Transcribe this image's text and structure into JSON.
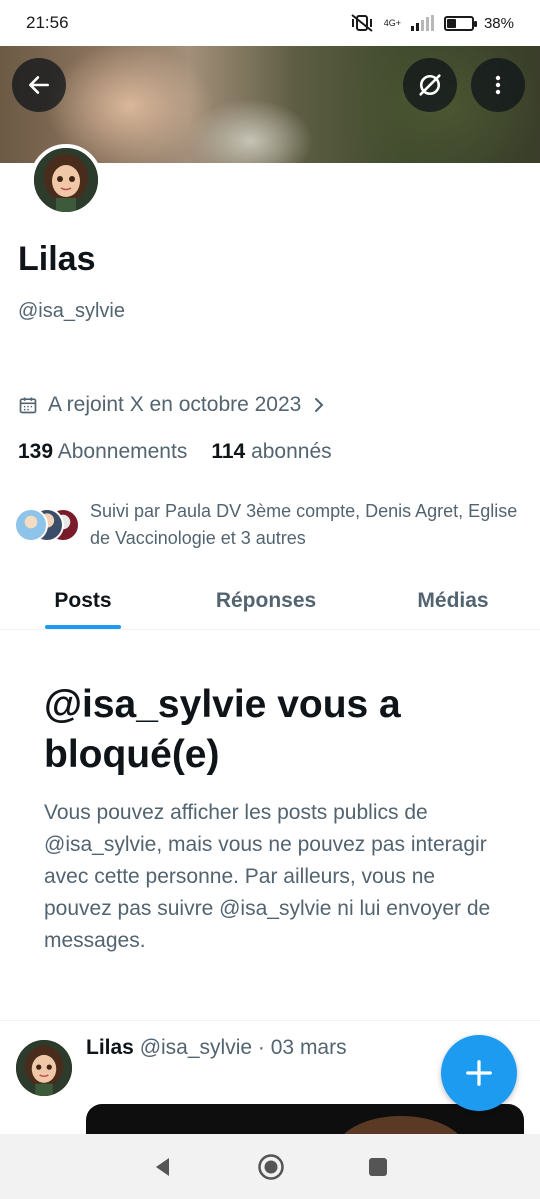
{
  "status_bar": {
    "time": "21:56",
    "network": "4G+",
    "battery": "38%",
    "battery_level": 0.38
  },
  "banner": {
    "back_icon": "arrow-left-icon",
    "grok_icon": "slash-circle-icon",
    "more_icon": "more-vertical-icon"
  },
  "profile": {
    "name": "Lilas",
    "handle": "@isa_sylvie",
    "joined": "A rejoint X en octobre 2023",
    "following_count": "139",
    "following_label": "Abonnements",
    "followers_count": "114",
    "followers_label": "abonnés",
    "followed_by": "Suivi par Paula DV 3ème compte, Denis Agret, Eglise de Vaccinologie et 3 autres"
  },
  "tabs": [
    {
      "label": "Posts",
      "active": true
    },
    {
      "label": "Réponses",
      "active": false
    },
    {
      "label": "Médias",
      "active": false
    }
  ],
  "blocked": {
    "title": "@isa_sylvie vous a bloqué(e)",
    "message": "Vous pouvez afficher les posts publics de @isa_sylvie, mais vous ne pouvez pas interagir avec cette personne. Par ailleurs, vous ne pouvez pas suivre @isa_sylvie ni lui envoyer de messages."
  },
  "post": {
    "name": "Lilas",
    "handle": "@isa_sylvie",
    "separator": "·",
    "date": "03 mars"
  },
  "fab": {
    "icon": "plus-icon"
  },
  "colors": {
    "accent": "#1d9bf0",
    "text_primary": "#0f1419",
    "text_secondary": "#536471"
  }
}
